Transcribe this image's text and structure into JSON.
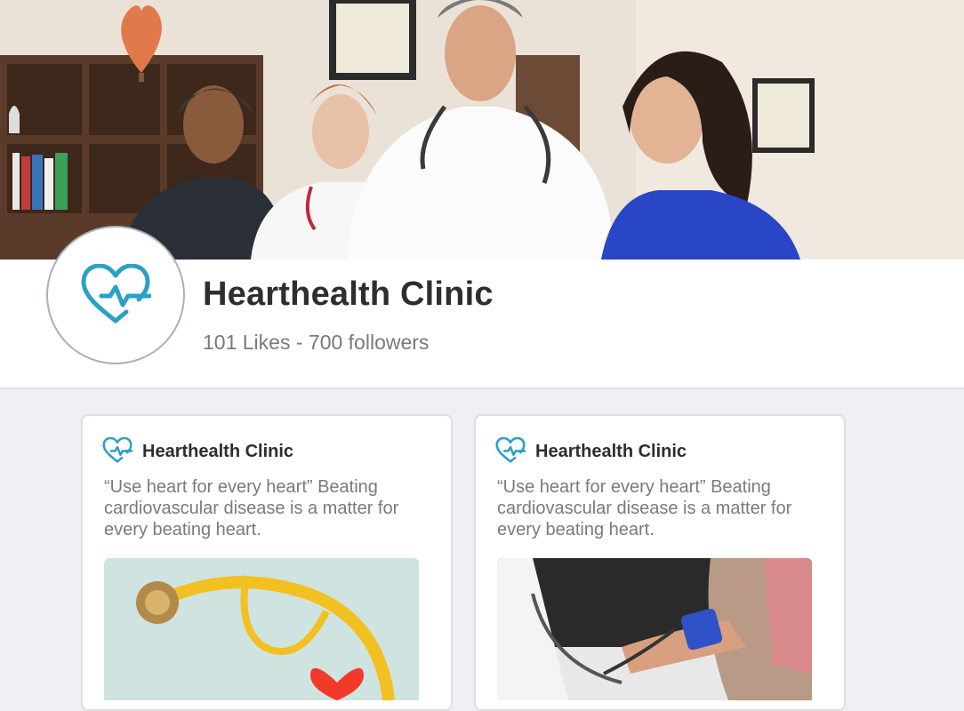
{
  "page": {
    "name": "Hearthealth Clinic",
    "stats": "101 Likes - 700 followers",
    "logo_icon": "heart-pulse-icon"
  },
  "colors": {
    "brand": "#2ba0c8",
    "background": "#eef0f3",
    "title_text": "#2e2e2e",
    "muted_text": "#7a7a7a"
  },
  "posts": [
    {
      "author": "Hearthealth Clinic",
      "text": "“Use heart for every heart” Beating cardiovascular disease is a matter for every beating heart.",
      "image": "stethoscope-and-heart-image"
    },
    {
      "author": "Hearthealth Clinic",
      "text": "“Use heart for every heart” Beating cardiovascular disease is a matter for every beating heart.",
      "image": "blood-pressure-measurement-image"
    }
  ]
}
